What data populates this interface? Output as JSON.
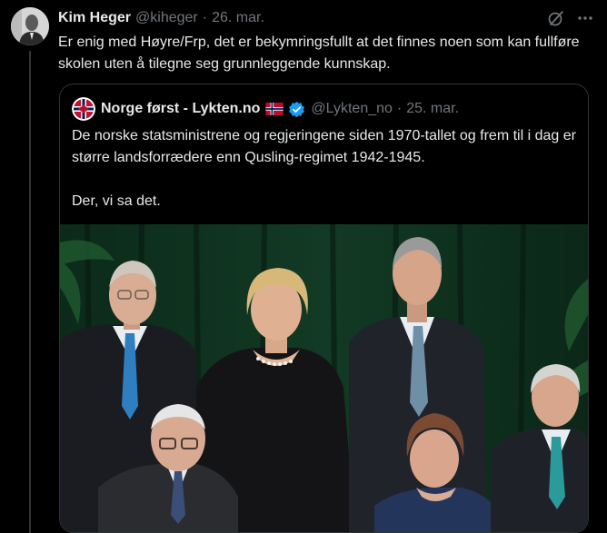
{
  "tweet": {
    "author_name": "Kim Heger",
    "handle": "@kiheger",
    "separator": "·",
    "date": "26. mar.",
    "text": "Er enig med Høyre/Frp, det er bekymringsfullt at det finnes noen som kan fullføre skolen uten å tilegne seg grunnleggende kunnskap."
  },
  "quote": {
    "author_name": "Norge først - Lykten.no",
    "handle": "@Lykten_no",
    "separator": "·",
    "date": "25. mar.",
    "text_paragraph_1": "De norske statsministrene og regjeringene siden 1970-tallet og frem til i dag er større landsforrædere enn Qusling-regimet 1942-1945.",
    "text_paragraph_2": "Der, vi sa det.",
    "badge": "verified-icon",
    "flag": "norway-flag-icon"
  },
  "colors": {
    "background": "#000000",
    "text": "#e7e9ea",
    "muted": "#71767b",
    "border": "#2f3336",
    "verified": "#1d9bf0"
  },
  "icons": [
    "grok-icon",
    "more-icon",
    "norway-flag-icon",
    "verified-icon"
  ]
}
